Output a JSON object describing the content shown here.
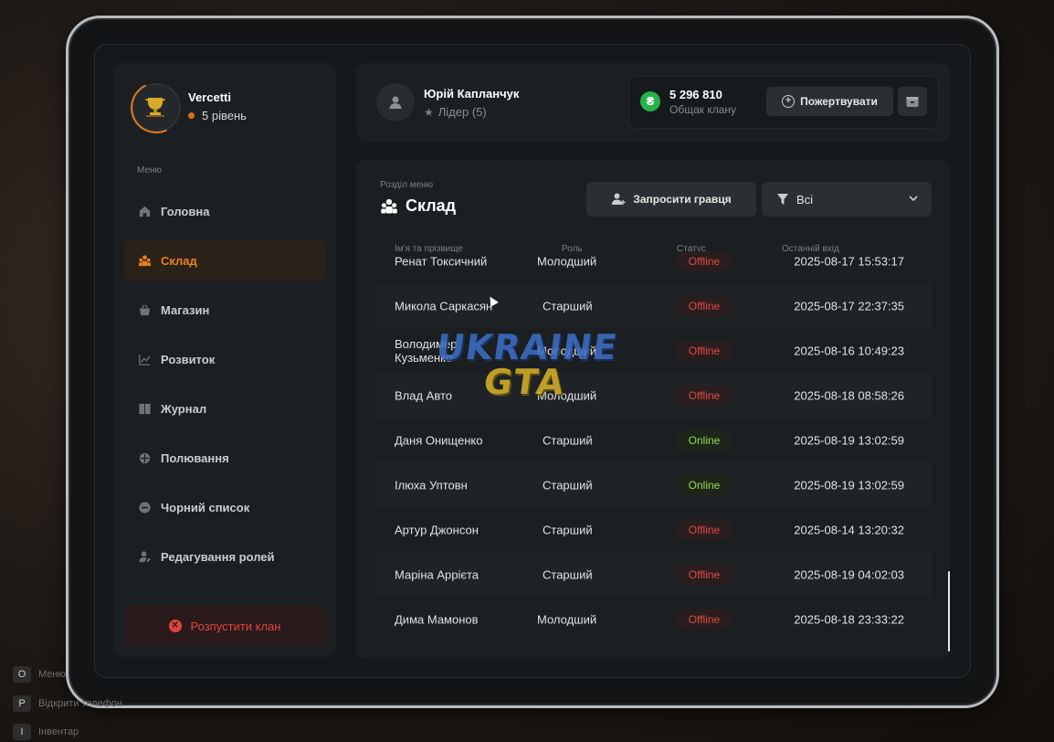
{
  "clan": {
    "name": "Vercetti",
    "level": "5 рівень"
  },
  "menu": {
    "caption": "Меню",
    "items": [
      {
        "label": "Головна",
        "icon": "home-icon",
        "active": false
      },
      {
        "label": "Склад",
        "icon": "people-icon",
        "active": true
      },
      {
        "label": "Магазин",
        "icon": "basket-icon",
        "active": false
      },
      {
        "label": "Розвиток",
        "icon": "chart-icon",
        "active": false
      },
      {
        "label": "Журнал",
        "icon": "book-icon",
        "active": false
      },
      {
        "label": "Полювання",
        "icon": "crosshair-icon",
        "active": false
      },
      {
        "label": "Чорний список",
        "icon": "minus-circle-icon",
        "active": false
      },
      {
        "label": "Редагування ролей",
        "icon": "user-edit-icon",
        "active": false
      }
    ],
    "disband_label": "Розпустити клан"
  },
  "leader": {
    "name": "Юрій Капланчук",
    "role": "Лідер (5)"
  },
  "bank": {
    "amount": "5 296 810",
    "label": "Общак клану",
    "currency_symbol": "₴",
    "donate_label": "Пожертвувати"
  },
  "section": {
    "caption": "Розділ меню",
    "title": "Склад",
    "invite_label": "Запросити гравця",
    "filter_value": "Всі"
  },
  "table": {
    "headers": {
      "name": "Ім'я та прізвище",
      "role": "Роль",
      "status": "Статус",
      "last_login": "Останній вхід"
    },
    "rows": [
      {
        "name": "Ренат Токсичний",
        "role": "Молодший",
        "status": "Offline",
        "last_login": "2025-08-17 15:53:17"
      },
      {
        "name": "Микола Саркасян",
        "role": "Старший",
        "status": "Offline",
        "last_login": "2025-08-17 22:37:35"
      },
      {
        "name": "Володимер Кузьменко",
        "role": "Молодший",
        "status": "Offline",
        "last_login": "2025-08-16 10:49:23"
      },
      {
        "name": "Влад Авто",
        "role": "Молодший",
        "status": "Offline",
        "last_login": "2025-08-18 08:58:26"
      },
      {
        "name": "Даня Онищенко",
        "role": "Старший",
        "status": "Online",
        "last_login": "2025-08-19 13:02:59"
      },
      {
        "name": "Ілюха Уптовн",
        "role": "Старший",
        "status": "Online",
        "last_login": "2025-08-19 13:02:59"
      },
      {
        "name": "Артур Джонсон",
        "role": "Старший",
        "status": "Offline",
        "last_login": "2025-08-14 13:20:32"
      },
      {
        "name": "Маріна Аррієта",
        "role": "Старший",
        "status": "Offline",
        "last_login": "2025-08-19 04:02:03"
      },
      {
        "name": "Дима Мамонов",
        "role": "Молодший",
        "status": "Offline",
        "last_login": "2025-08-18 23:33:22"
      }
    ]
  },
  "watermark": {
    "line1": "UKRAINE",
    "line2": "GTA"
  },
  "hints": [
    {
      "key": "O",
      "label": "Меню"
    },
    {
      "key": "P",
      "label": "Відкрити телефон"
    },
    {
      "key": "I",
      "label": "Інвентар"
    }
  ],
  "colors": {
    "accent": "#e8801f",
    "online": "#8fd94a",
    "offline": "#e24a42",
    "money": "#27b34a"
  }
}
